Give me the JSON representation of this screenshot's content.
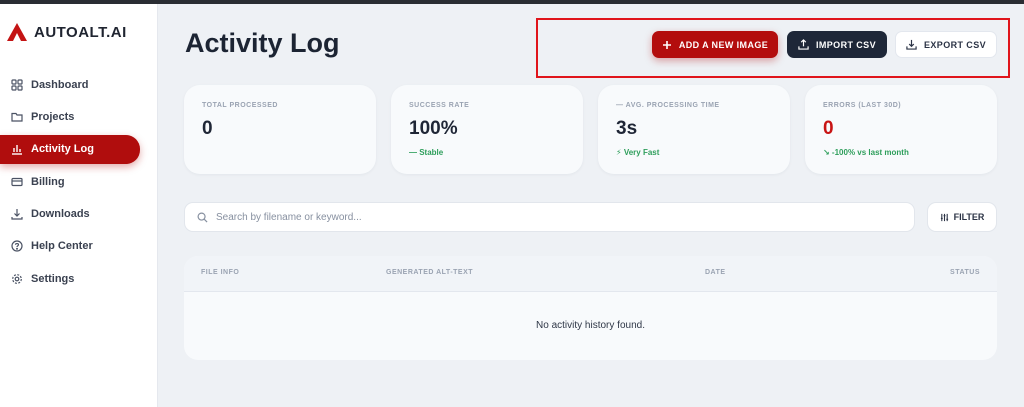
{
  "brand": {
    "name": "AUTOALT.AI"
  },
  "sidebar": {
    "items": [
      {
        "label": "Dashboard",
        "icon": "grid-icon",
        "active": false
      },
      {
        "label": "Projects",
        "icon": "folder-icon",
        "active": false
      },
      {
        "label": "Activity Log",
        "icon": "bar-chart-icon",
        "active": true
      },
      {
        "label": "Billing",
        "icon": "credit-card-icon",
        "active": false
      },
      {
        "label": "Downloads",
        "icon": "download-icon",
        "active": false
      },
      {
        "label": "Help Center",
        "icon": "help-circle-icon",
        "active": false
      },
      {
        "label": "Settings",
        "icon": "gear-icon",
        "active": false
      }
    ]
  },
  "page": {
    "title": "Activity Log"
  },
  "actions": {
    "add_label": "ADD A NEW IMAGE",
    "import_label": "IMPORT CSV",
    "export_label": "EXPORT CSV"
  },
  "stats": [
    {
      "label": "TOTAL PROCESSED",
      "value": "0",
      "sub": ""
    },
    {
      "label": "SUCCESS RATE",
      "value": "100%",
      "sub": "— Stable"
    },
    {
      "label": "— AVG. PROCESSING TIME",
      "value": "3s",
      "sub": "⚡ Very Fast"
    },
    {
      "label": "ERRORS (LAST 30D)",
      "value": "0",
      "sub": "↘ -100% vs last month"
    }
  ],
  "search": {
    "placeholder": "Search by filename or keyword...",
    "value": ""
  },
  "filter": {
    "label": "FILTER"
  },
  "table": {
    "columns": [
      "FILE INFO",
      "GENERATED ALT-TEXT",
      "DATE",
      "STATUS"
    ],
    "empty_message": "No activity history found."
  },
  "colors": {
    "accent": "#b00d0d",
    "dark_button": "#1e2738",
    "success": "#2e9e5b",
    "error": "#c81414"
  }
}
